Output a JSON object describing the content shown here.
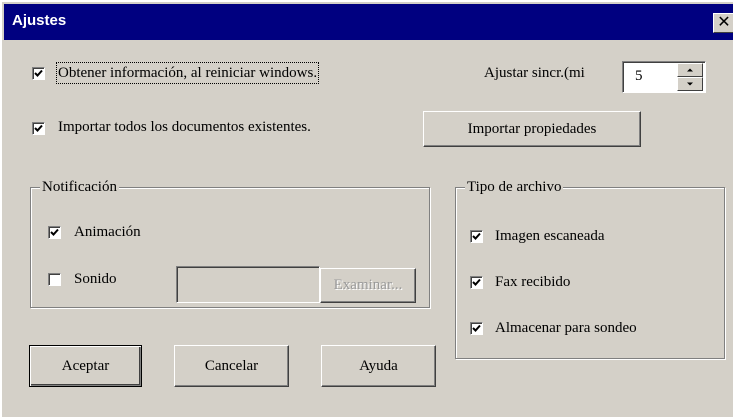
{
  "window": {
    "title": "Ajustes",
    "close_glyph": "✕"
  },
  "options": {
    "obtener_info": {
      "label": "Obtener información, al reiniciar windows.",
      "checked": true
    },
    "importar_docs": {
      "label": "Importar todos los documentos existentes.",
      "checked": true
    }
  },
  "sync": {
    "label": "Ajustar sincr.(mi",
    "value": "5"
  },
  "import_props_button": "Importar propiedades",
  "notificacion": {
    "legend": "Notificación",
    "animacion": {
      "label": "Animación",
      "checked": true
    },
    "sonido": {
      "label": "Sonido",
      "checked": false,
      "path_value": ""
    },
    "examinar_button": "Examinar..."
  },
  "tipo_archivo": {
    "legend": "Tipo de archivo",
    "items": [
      {
        "label": "Imagen escaneada",
        "checked": true
      },
      {
        "label": "Fax recibido",
        "checked": true
      },
      {
        "label": "Almacenar para sondeo",
        "checked": true
      }
    ]
  },
  "buttons": {
    "accept": "Aceptar",
    "cancel": "Cancelar",
    "help": "Ayuda"
  }
}
